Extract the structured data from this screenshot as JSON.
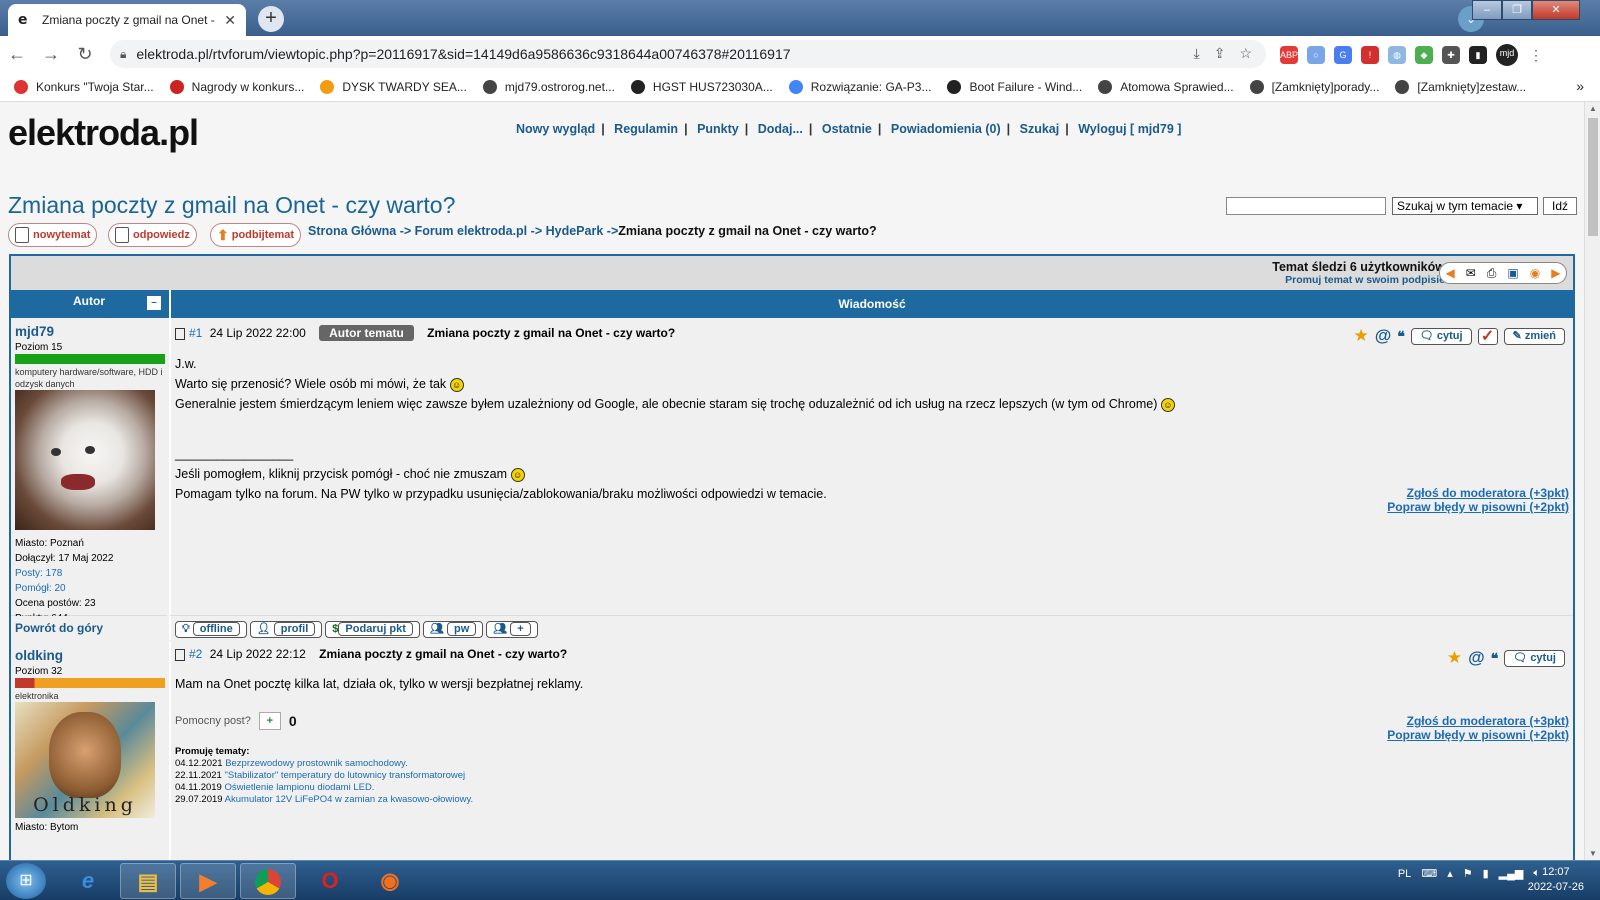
{
  "browser": {
    "tab_title": "Zmiana poczty z gmail na Onet -",
    "url": "elektroda.pl/rtvforum/viewtopic.php?p=20116917&sid=14149d6a9586636c9318644a00746378#20116917",
    "profile": "mjd",
    "bookmarks": [
      {
        "label": "Konkurs \"Twoja Star...",
        "color": "#d33"
      },
      {
        "label": "Nagrody w konkurs...",
        "color": "#c22"
      },
      {
        "label": "DYSK TWARDY SEA...",
        "color": "#f39c12"
      },
      {
        "label": "mjd79.ostrorog.net...",
        "color": "#444"
      },
      {
        "label": "HGST HUS723030A...",
        "color": "#222"
      },
      {
        "label": "Rozwiązanie: GA-P3...",
        "color": "#4285f4"
      },
      {
        "label": "Boot Failure - Wind...",
        "color": "#222"
      },
      {
        "label": "Atomowa Sprawied...",
        "color": "#444"
      },
      {
        "label": "[Zamknięty]porady...",
        "color": "#444"
      },
      {
        "label": "[Zamknięty]zestaw...",
        "color": "#444"
      }
    ]
  },
  "site": {
    "logo": "elektroda.pl",
    "nav": [
      "Nowy wygląd",
      "Regulamin",
      "Punkty",
      "Dodaj...",
      "Ostatnie",
      "Powiadomienia (0)",
      "Szukaj",
      "Wyloguj [ mjd79 ]"
    ],
    "search_select": "Szukaj w tym temacie",
    "search_go": "Idź"
  },
  "topic": {
    "title": "Zmiana poczty z gmail na Onet - czy warto?",
    "buttons": {
      "new": "nowytemat",
      "reply": "odpowiedz",
      "bump": "podbijtemat"
    },
    "breadcrumb": {
      "home": "Strona Główna",
      "forum": "Forum elektroda.pl",
      "section": "HydePark",
      "sep": "->",
      "current": "Zmiana poczty z gmail na Onet - czy warto?"
    },
    "followers": "Temat śledzi 6 użytkowników",
    "promote": "Promuj temat w swoim podpisie"
  },
  "table": {
    "author_header": "Autor",
    "message_header": "Wiadomość"
  },
  "posts": [
    {
      "author": "mjd79",
      "level": "Poziom 15",
      "level_color": "#22aa22",
      "spec": "komputery hardware/software, HDD i odzysk danych",
      "city": "Miasto: Poznań",
      "joined": "Dołączył: 17 Maj 2022",
      "posts": "Posty: 178",
      "helped": "Pomógł: 20",
      "rating": "Ocena postów: 23",
      "points": "Punkty: 644",
      "num": "#1",
      "date": "24 Lip 2022 22:00",
      "badge": "Autor tematu",
      "subject": "Zmiana poczty z gmail na Onet - czy warto?",
      "quote": "cytuj",
      "edit": "zmień",
      "body": [
        "J.w.",
        "Warto się przenosić? Wiele osób mi mówi, że tak",
        "Generalnie jestem śmierdzącym leniem więc zawsze byłem uzależniony od Google, ale obecnie staram się trochę oduzależnić od ich usług na rzecz lepszych (w tym od Chrome)"
      ],
      "sig_line": "_________________",
      "sig": [
        "Jeśli pomogłem, kliknij przycisk pomógł - choć nie zmuszam",
        "Pomagam tylko na forum. Na PW tylko w przypadku usunięcia/zablokowania/braku możliwości odpowiedzi w temacie."
      ],
      "report": "Zgłoś do moderatora (+3pkt)",
      "spell": "Popraw błędy w pisowni (+2pkt)",
      "back_top": "Powrót do góry",
      "user_buttons": [
        "offline",
        "profil",
        "Podaruj pkt",
        "pw",
        "+"
      ]
    },
    {
      "author": "oldking",
      "level": "Poziom 32",
      "spec": "elektronika",
      "avatar_text": "Oldking",
      "city": "Miasto: Bytom",
      "num": "#2",
      "date": "24 Lip 2022 22:12",
      "subject": "Zmiana poczty z gmail na Onet - czy warto?",
      "quote": "cytuj",
      "body": "Mam na Onet pocztę kilka lat, działa ok, tylko w wersji bezpłatnej reklamy.",
      "helpful_label": "Pomocny post?",
      "helpful_plus": "+",
      "helpful_count": "0",
      "promo_header": "Promuję tematy:",
      "promo": [
        {
          "date": "04.12.2021",
          "title": "Bezprzewodowy prostownik samochodowy."
        },
        {
          "date": "22.11.2021",
          "title": "\"Stabilizator\" temperatury do lutownicy transformatorowej"
        },
        {
          "date": "04.11.2019",
          "title": "Oświetlenie lampionu diodami LED."
        },
        {
          "date": "29.07.2019",
          "title": "Akumulator 12V LiFePO4 w zamian za kwasowo-ołowiowy."
        }
      ],
      "report": "Zgłoś do moderatora (+3pkt)",
      "spell": "Popraw błędy w pisowni (+2pkt)"
    }
  ],
  "taskbar": {
    "lang": "PL",
    "time": "12:07",
    "date": "2022-07-26"
  }
}
